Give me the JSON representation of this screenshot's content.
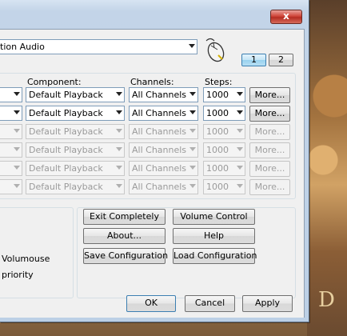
{
  "window": {
    "close_glyph": "x"
  },
  "device_select": {
    "value": "tion Audio"
  },
  "page_tabs": [
    "1",
    "2"
  ],
  "columns": {
    "component": "Component:",
    "channels": "Channels:",
    "steps": "Steps:"
  },
  "rows": [
    {
      "component": "Default Playback",
      "channels": "All Channels",
      "steps": "1000",
      "more": "More...",
      "enabled": true
    },
    {
      "component": "Default Playback",
      "channels": "All Channels",
      "steps": "1000",
      "more": "More...",
      "enabled": true
    },
    {
      "component": "Default Playback",
      "channels": "All Channels",
      "steps": "1000",
      "more": "More...",
      "enabled": false
    },
    {
      "component": "Default Playback",
      "channels": "All Channels",
      "steps": "1000",
      "more": "More...",
      "enabled": false
    },
    {
      "component": "Default Playback",
      "channels": "All Channels",
      "steps": "1000",
      "more": "More...",
      "enabled": false
    },
    {
      "component": "Default Playback",
      "channels": "All Channels",
      "steps": "1000",
      "more": "More...",
      "enabled": false
    }
  ],
  "actions": {
    "exit": "Exit Completely",
    "volume_control": "Volume Control",
    "about": "About...",
    "help": "Help",
    "save_config": "Save Configuration",
    "load_config": "Load Configuration"
  },
  "left_texts": {
    "volumouse": "Volumouse",
    "priority": "priority"
  },
  "footer": {
    "ok": "OK",
    "cancel": "Cancel",
    "apply": "Apply"
  },
  "background_text": "D",
  "icons": {
    "mouse": "mouse-icon",
    "close": "close-icon"
  }
}
